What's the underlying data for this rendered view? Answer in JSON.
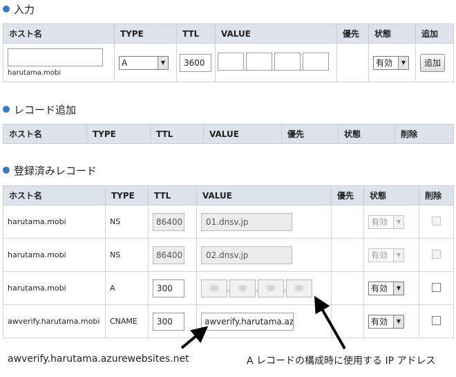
{
  "section_input": {
    "title": "入力"
  },
  "section_add": {
    "title": "レコード追加"
  },
  "section_registered": {
    "title": "登録済みレコード"
  },
  "headers": {
    "host": "ホスト名",
    "type": "TYPE",
    "ttl": "TTL",
    "value": "VALUE",
    "priority": "優先",
    "status": "状態",
    "add": "追加",
    "delete": "削除"
  },
  "input_row": {
    "host_value": "",
    "domain_suffix": "harutama.mobi",
    "type": "A",
    "ttl": "3600",
    "status": "有効",
    "add_button": "追加"
  },
  "records": [
    {
      "host": "harutama.mobi",
      "type": "NS",
      "ttl": "86400",
      "value": "01.dnsv.jp",
      "status": "有効",
      "editable": false
    },
    {
      "host": "harutama.mobi",
      "type": "NS",
      "ttl": "86400",
      "value": "02.dnsv.jp",
      "status": "有効",
      "editable": false
    },
    {
      "host": "harutama.mobi",
      "type": "A",
      "ttl": "300",
      "value": "",
      "status": "有効",
      "editable": true
    },
    {
      "host": "awverify.harutama.mobi",
      "type": "CNAME",
      "ttl": "300",
      "value": "awverify.harutama.azure",
      "status": "有効",
      "editable": true
    }
  ],
  "annotations": {
    "cname_note": "awverify.harutama.azurewebsites.net",
    "ip_note": "A レコードの構成時に使用する IP アドレス"
  },
  "colors": {
    "bullet": "#3a78c8",
    "header_bg": "#dde3ea"
  }
}
